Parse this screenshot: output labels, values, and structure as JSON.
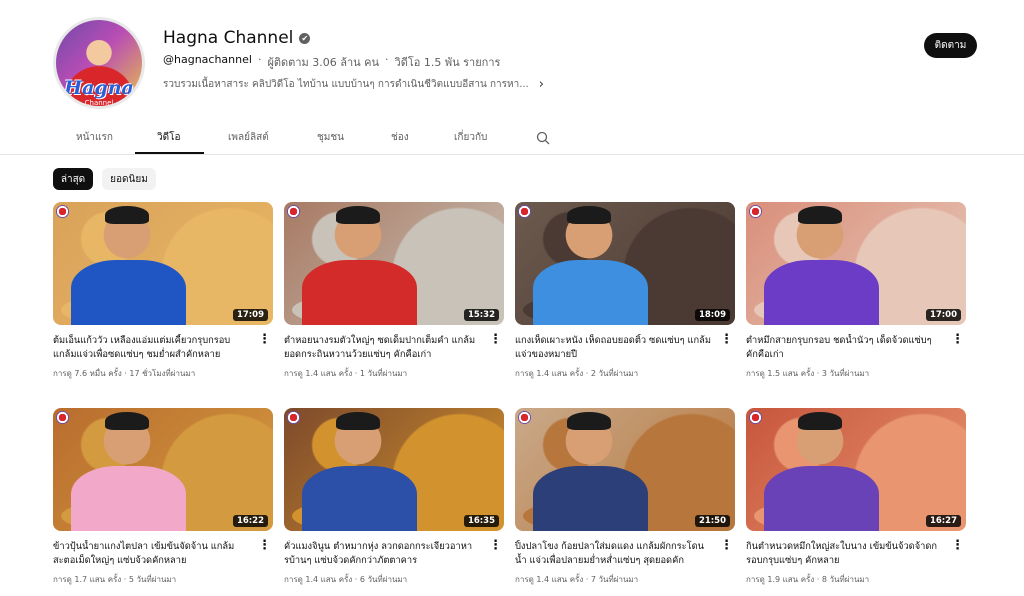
{
  "channel": {
    "name": "Hagna Channel",
    "verified_icon": "✔",
    "handle": "@hagnachannel",
    "subscribers": "ผู้ติดตาม 3.06 ล้าน คน",
    "video_count": "วิดีโอ 1.5 พัน รายการ",
    "separator": "‧",
    "description": "รวบรวมเนื้อหาสาระ คลิปวิดีโอ ไทบ้าน แบบบ้านๆ การดำเนินชีวิตแบบอีสาน การหา...",
    "description_more": "›",
    "avatar_logo": "Hagna",
    "avatar_sub": "Channel",
    "subscribe_label": "ติดตาม"
  },
  "tabs": [
    {
      "label": "หน้าแรก"
    },
    {
      "label": "วิดีโอ"
    },
    {
      "label": "เพลย์ลิสต์"
    },
    {
      "label": "ชุมชน"
    },
    {
      "label": "ช่อง"
    },
    {
      "label": "เกี่ยวกับ"
    }
  ],
  "chips": [
    {
      "label": "ล่าสุด"
    },
    {
      "label": "ยอดนิยม"
    }
  ],
  "videos": [
    {
      "title": "ต้มเอ็นแก้ววัว เหลืองแอ่มแต่มเคี้ยวกรุบกรอบ แกล้มแจ่วเพื่อซดแซ่บๆ ชมย่ำผสำคักหลาย",
      "views": "การดู 7.6 หมื่น ครั้ง",
      "age": "17 ชั่วโมงที่ผ่านมา",
      "duration": "17:09",
      "shirt": "#1f56c4",
      "food": "#e8b765",
      "bg": "#d9a25a"
    },
    {
      "title": "ตำหอยนางรมตัวใหญ่ๆ ซดเด็มปากเต็มคำ แกล้มยอดกระถินหวานว้วยแซ่บๆ คักคือเก่า",
      "views": "การดู 1.4 แสน ครั้ง",
      "age": "1 วันที่ผ่านมา",
      "duration": "15:32",
      "shirt": "#d32a2a",
      "food": "#c9c2b8",
      "bg": "#a87a63"
    },
    {
      "title": "แกงเห็ดเผาะหนัง เห็ดถอบยอดติ้ว ซดแซ่บๆ แกล้มแจ่วของหมายปี",
      "views": "การดู 1.4 แสน ครั้ง",
      "age": "2 วันที่ผ่านมา",
      "duration": "18:09",
      "shirt": "#3f8fe0",
      "food": "#4b3a33",
      "bg": "#6c5a4e"
    },
    {
      "title": "ตำหมึกสายกรุบกรอบ ชดน้ำนัวๆ เด็ดจ้วดแซ่บๆ คักคือเก่า",
      "views": "การดู 1.5 แสน ครั้ง",
      "age": "3 วันที่ผ่านมา",
      "duration": "17:00",
      "shirt": "#6c3cc6",
      "food": "#e7c7b8",
      "bg": "#d98f7b"
    },
    {
      "title": "ข้าวปุ้นน้ำยาแกงไตปลา เข้มข้นจัดจ้าน แกล้มสะตอเม็ดใหญ่ๆ แซ่บจ้วดคักหลาย",
      "views": "การดู 1.7 แสน ครั้ง",
      "age": "5 วันที่ผ่านมา",
      "duration": "16:22",
      "shirt": "#f2a8c9",
      "food": "#d49a3f",
      "bg": "#b96d2e"
    },
    {
      "title": "คั่วแมงจินูน ตำหมากหุ่ง ลวกดอกกระเจียวอาหารบ้านๆ แซ่บจ้วดคักกว่าภัตตาคาร",
      "views": "การดู 1.4 แสน ครั้ง",
      "age": "6 วันที่ผ่านมา",
      "duration": "16:35",
      "shirt": "#2c4fa8",
      "food": "#d2922e",
      "bg": "#7d4a2c"
    },
    {
      "title": "ปิ้งปลาโขง ก้อยปลาใส่มดแดง แกล้มผักกระโดนน้ำ แจ่วเพื่อปลายมย่ำหส่ำแซ่บๆ สุดยอดคัก",
      "views": "การดู 1.4 แสน ครั้ง",
      "age": "7 วันที่ผ่านมา",
      "duration": "21:50",
      "shirt": "#2c3f78",
      "food": "#b7763c",
      "bg": "#c9a98a"
    },
    {
      "title": "กินตำหนวดหมึกใหญ่สะใบนาง เข้มข้นจ้วดจ้าดกรอบกรุบแซ่บๆ คักหลาย",
      "views": "การดู 1.9 แสน ครั้ง",
      "age": "8 วันที่ผ่านมา",
      "duration": "16:27",
      "shirt": "#6a42b8",
      "food": "#e89570",
      "bg": "#c7563c"
    }
  ],
  "icons": {
    "search": "search-icon",
    "more": "more-vert-icon"
  }
}
